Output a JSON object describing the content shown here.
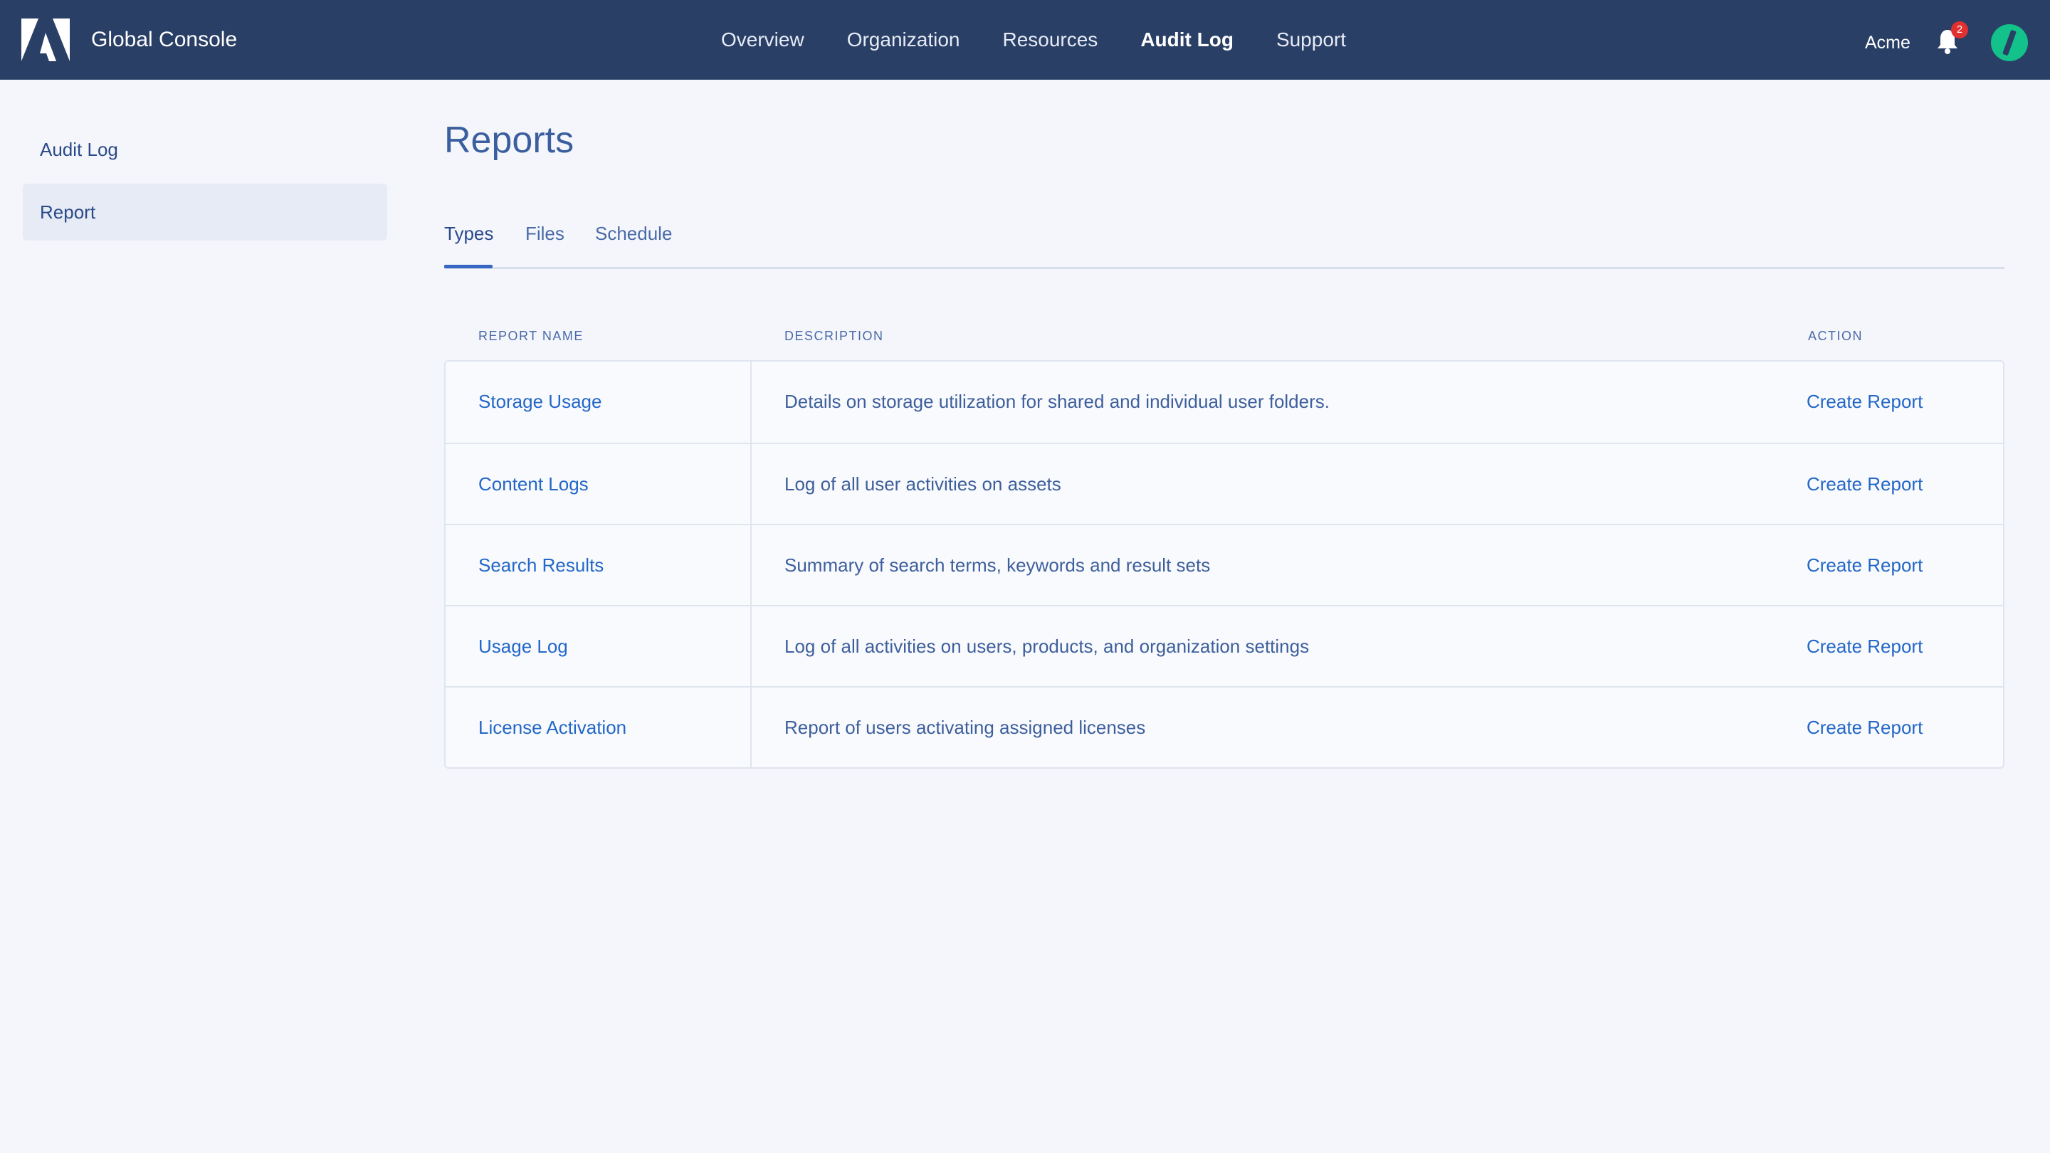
{
  "app": {
    "title": "Global Console",
    "logo_icon": "adobe-logo-icon"
  },
  "nav": {
    "items": [
      {
        "label": "Overview",
        "active": false
      },
      {
        "label": "Organization",
        "active": false
      },
      {
        "label": "Resources",
        "active": false
      },
      {
        "label": "Audit Log",
        "active": true
      },
      {
        "label": "Support",
        "active": false
      }
    ]
  },
  "header_right": {
    "org_name": "Acme",
    "notification_count": "2",
    "bell_icon": "bell-icon",
    "avatar_icon": "avatar-icon"
  },
  "sidebar": {
    "items": [
      {
        "label": "Audit Log",
        "selected": false
      },
      {
        "label": "Report",
        "selected": true
      }
    ]
  },
  "main": {
    "title": "Reports",
    "tabs": [
      {
        "label": "Types",
        "active": true
      },
      {
        "label": "Files",
        "active": false
      },
      {
        "label": "Schedule",
        "active": false
      }
    ],
    "table": {
      "columns": [
        "REPORT NAME",
        "DESCRIPTION",
        "ACTION"
      ],
      "rows": [
        {
          "name": "Storage Usage",
          "description": "Details on storage utilization for shared and individual user folders.",
          "action": "Create Report"
        },
        {
          "name": "Content Logs",
          "description": "Log of all user activities on assets",
          "action": "Create Report"
        },
        {
          "name": "Search Results",
          "description": "Summary of search terms, keywords and result sets",
          "action": "Create Report"
        },
        {
          "name": "Usage Log",
          "description": "Log of all activities on users, products, and organization settings",
          "action": "Create Report"
        },
        {
          "name": "License Activation",
          "description": "Report of users activating assigned licenses",
          "action": "Create Report"
        }
      ]
    }
  },
  "colors": {
    "topbar": "#2a3f66",
    "background": "#f4f6fb",
    "link": "#2367c8",
    "accent": "#3466c2",
    "avatar": "#12c28a",
    "badge": "#e03030"
  }
}
